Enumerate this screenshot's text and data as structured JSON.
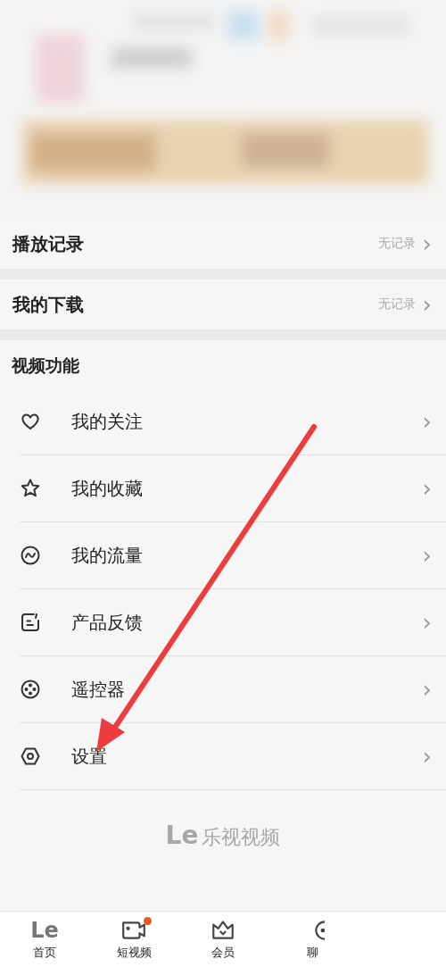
{
  "records": [
    {
      "label": "播放记录",
      "value": "无记录",
      "chevron": "›"
    },
    {
      "label": "我的下载",
      "value": "无记录",
      "chevron": "›"
    }
  ],
  "section": {
    "title": "视频功能",
    "items": [
      {
        "kind": "heart",
        "label": "我的关注",
        "chevron": "›"
      },
      {
        "kind": "star",
        "label": "我的收藏",
        "chevron": "›"
      },
      {
        "kind": "traffic",
        "label": "我的流量",
        "chevron": "›"
      },
      {
        "kind": "feedback",
        "label": "产品反馈",
        "chevron": "›"
      },
      {
        "kind": "remote",
        "label": "遥控器",
        "chevron": "›"
      },
      {
        "kind": "settings",
        "label": "设置",
        "chevron": "›"
      }
    ]
  },
  "brand": {
    "mark": "Le",
    "name": "乐视视频"
  },
  "tab_bar": [
    {
      "kind": "home",
      "mark": "Le",
      "label": "首页",
      "badge": false
    },
    {
      "kind": "video",
      "label": "短视频",
      "badge": true
    },
    {
      "kind": "vip",
      "label": "会员",
      "badge": false
    },
    {
      "kind": "chat",
      "label": "聊",
      "badge": false
    }
  ]
}
